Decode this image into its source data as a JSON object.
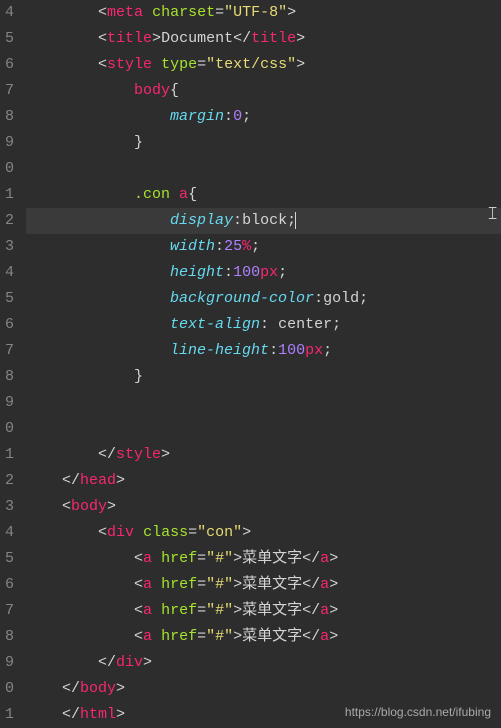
{
  "watermark": "https://blog.csdn.net/ifubing",
  "gutter": [
    "4",
    "5",
    "6",
    "7",
    "8",
    "9",
    "0",
    "1",
    "2",
    "3",
    "4",
    "5",
    "6",
    "7",
    "8",
    "9",
    "0",
    "1",
    "2",
    "3",
    "4",
    "5",
    "6",
    "7",
    "8",
    "9",
    "0",
    "1"
  ],
  "code": {
    "l4": {
      "indent": "        ",
      "tag": "meta",
      "attr": "charset",
      "val": "\"UTF-8\""
    },
    "l5": {
      "indent": "        ",
      "tag": "title",
      "text": "Document"
    },
    "l6": {
      "indent": "        ",
      "tag": "style",
      "attr": "type",
      "val": "\"text/css\""
    },
    "l7": {
      "indent": "            ",
      "selector": "body",
      "brace": "{"
    },
    "l8": {
      "indent": "                ",
      "prop": "margin",
      "val": "0"
    },
    "l9": {
      "indent": "            ",
      "brace": "}"
    },
    "l11": {
      "indent": "            ",
      "cls": ".con ",
      "tag": "a",
      "brace": "{"
    },
    "l12": {
      "indent": "                ",
      "prop": "display",
      "val": "block"
    },
    "l13": {
      "indent": "                ",
      "prop": "width",
      "num": "25",
      "unit": "%"
    },
    "l14": {
      "indent": "                ",
      "prop": "height",
      "num": "100",
      "unit": "px"
    },
    "l15": {
      "indent": "                ",
      "prop": "background-color",
      "val": "gold"
    },
    "l16": {
      "indent": "                ",
      "prop": "text-align",
      "val": " center"
    },
    "l17": {
      "indent": "                ",
      "prop": "line-height",
      "num": "100",
      "unit": "px"
    },
    "l18": {
      "indent": "            ",
      "brace": "}"
    },
    "l21": {
      "indent": "        ",
      "close": "style"
    },
    "l22": {
      "indent": "    ",
      "close": "head"
    },
    "l23": {
      "indent": "    ",
      "tag": "body"
    },
    "l24": {
      "indent": "        ",
      "tag": "div",
      "attr": "class",
      "val": "\"con\""
    },
    "l25": {
      "indent": "            ",
      "tag": "a",
      "attr": "href",
      "val": "\"#\"",
      "text": "菜单文字"
    },
    "l26": {
      "indent": "            ",
      "tag": "a",
      "attr": "href",
      "val": "\"#\"",
      "text": "菜单文字"
    },
    "l27": {
      "indent": "            ",
      "tag": "a",
      "attr": "href",
      "val": "\"#\"",
      "text": "菜单文字"
    },
    "l28": {
      "indent": "            ",
      "tag": "a",
      "attr": "href",
      "val": "\"#\"",
      "text": "菜单文字"
    },
    "l29": {
      "indent": "        ",
      "close": "div"
    },
    "l30": {
      "indent": "    ",
      "close": "body"
    },
    "l31": {
      "indent": "    ",
      "close": "html"
    }
  }
}
